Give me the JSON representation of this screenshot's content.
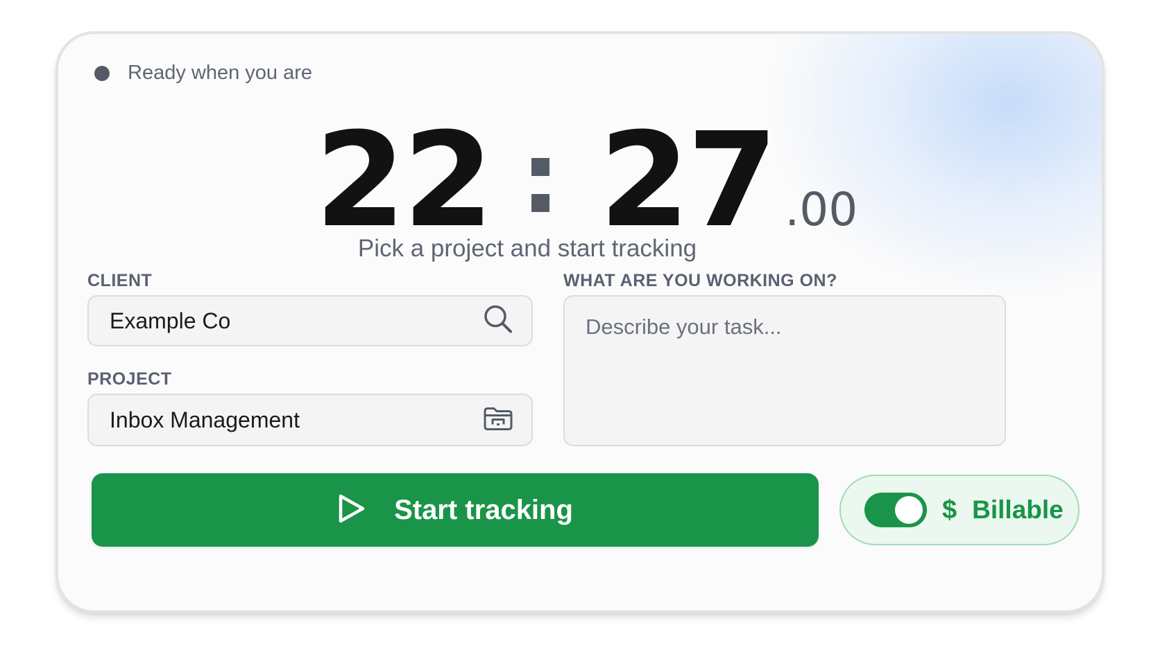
{
  "status": {
    "text": "Ready when you are"
  },
  "timer": {
    "hours": "22",
    "minutes": "27",
    "fraction": ".00"
  },
  "subtitle": "Pick a project and start tracking",
  "client": {
    "label": "CLIENT",
    "value": "Example Co",
    "icon": "search-icon"
  },
  "project": {
    "label": "PROJECT",
    "value": "Inbox Management",
    "icon": "folder-icon"
  },
  "task": {
    "label": "WHAT ARE YOU WORKING ON?",
    "placeholder": "Describe your task..."
  },
  "start_button": {
    "label": "Start tracking",
    "icon": "play-icon"
  },
  "billable": {
    "label": "Billable",
    "symbol": "$",
    "enabled": true
  },
  "colors": {
    "accent_green": "#1a9448",
    "status_dot": "#555b66"
  }
}
